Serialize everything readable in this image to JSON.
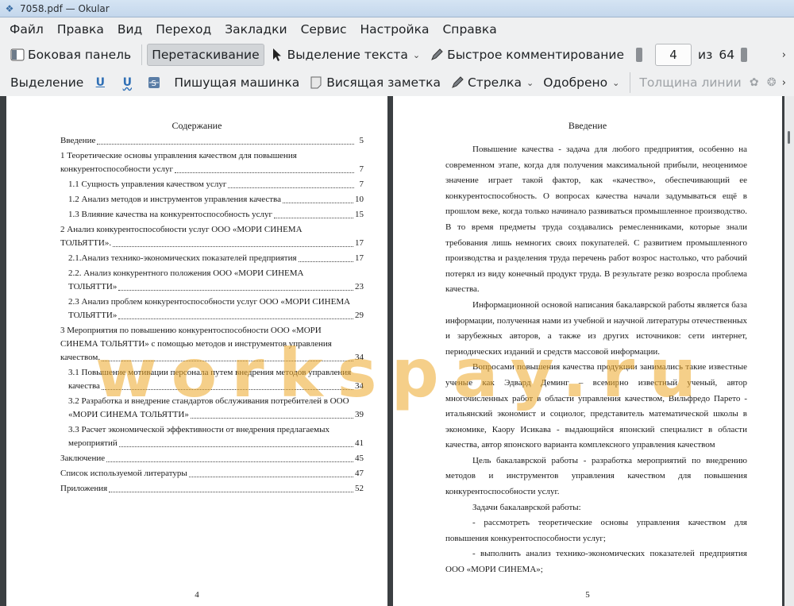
{
  "window": {
    "title": "7058.pdf  — Okular"
  },
  "menu": [
    "Файл",
    "Правка",
    "Вид",
    "Переход",
    "Закладки",
    "Сервис",
    "Настройка",
    "Справка"
  ],
  "toolbar1": {
    "sidebar": "Боковая панель",
    "drag": "Перетаскивание",
    "text_select": "Выделение текста",
    "quick_comment": "Быстрое комментирование",
    "page_current": "4",
    "page_of": "из",
    "page_total": "64"
  },
  "toolbar2": {
    "select": "Выделение",
    "typewriter": "Пишущая машинка",
    "sticky_note": "Висящая заметка",
    "arrow": "Стрелка",
    "approved": "Одобрено",
    "line_width": "Толщина линии"
  },
  "left_page": {
    "title": "Содержание",
    "toc": [
      {
        "lines": [
          "Введение"
        ],
        "page": "5",
        "indent": false
      },
      {
        "lines": [
          "1 Теоретические основы управления качеством для повышения",
          "конкурентоспособности услуг"
        ],
        "page": "7",
        "indent": false
      },
      {
        "lines": [
          "1.1 Сущность управления качеством услуг"
        ],
        "page": "7",
        "indent": true
      },
      {
        "lines": [
          "1.2 Анализ методов и инструментов управления качества"
        ],
        "page": "10",
        "indent": true
      },
      {
        "lines": [
          "1.3 Влияние качества на конкурентоспособность услуг"
        ],
        "page": "15",
        "indent": true
      },
      {
        "lines": [
          "2 Анализ конкурентоспособности услуг ООО «МОРИ СИНЕМА",
          "ТОЛЬЯТТИ»."
        ],
        "page": "17",
        "indent": false
      },
      {
        "lines": [
          "2.1.Анализ технико-экономических показателей предприятия"
        ],
        "page": "17",
        "indent": true
      },
      {
        "lines": [
          "2.2. Анализ конкурентного положения ООО «МОРИ СИНЕМА",
          "ТОЛЬЯТТИ»"
        ],
        "page": "23",
        "indent": true
      },
      {
        "lines": [
          "2.3 Анализ проблем конкурентоспособности услуг ООО «МОРИ СИНЕМА",
          "ТОЛЬЯТТИ»"
        ],
        "page": "29",
        "indent": true
      },
      {
        "lines": [
          "3 Мероприятия по повышению конкурентоспособности ООО «МОРИ",
          "СИНЕМА ТОЛЬЯТТИ» с помощью методов и инструментов управления",
          "качеством."
        ],
        "page": "34",
        "indent": false
      },
      {
        "lines": [
          "3.1 Повышение мотивации персонала путем внедрения методов управления",
          "качества"
        ],
        "page": "34",
        "indent": true
      },
      {
        "lines": [
          "3.2 Разработка и внедрение стандартов обслуживания потребителей в ООО",
          "«МОРИ СИНЕМА ТОЛЬЯТТИ»"
        ],
        "page": "39",
        "indent": true
      },
      {
        "lines": [
          "3.3    Расчет экономической эффективности от внедрения предлагаемых",
          "мероприятий"
        ],
        "page": "41",
        "indent": true
      },
      {
        "lines": [
          "Заключение"
        ],
        "page": "45",
        "indent": false
      },
      {
        "lines": [
          "Список используемой литературы"
        ],
        "page": "47",
        "indent": false
      },
      {
        "lines": [
          "Приложения"
        ],
        "page": "52",
        "indent": false
      }
    ],
    "page_number": "4"
  },
  "right_page": {
    "title": "Введение",
    "paragraphs": [
      "Повышение качества - задача для любого предприятия, особенно на современном этапе, когда для получения максимальной прибыли, неоценимое значение играет такой фактор, как «качество», обеспечивающий ее конкурентоспособность. О вопросах качества начали задумываться ещё в прошлом веке, когда только начинало развиваться промышленное производство. В то время предметы труда создавались ремесленниками, которые знали требования лишь немногих своих покупателей. С развитием промышленного производства и разделения труда перечень работ возрос настолько, что рабочий потерял из виду конечный продукт труда. В результате резко возросла проблема качества.",
      "Информационной основой написания бакалаврской работы является база информации, полученная нами из учебной и научной литературы отечественных и зарубежных авторов, а также из других источников: сети интернет, периодических изданий и средств массовой информации.",
      "Вопросами повышения качества продукции занимались такие известные ученые как Эдвард Деминг – всемирно известный ученый, автор многочисленных работ в области управления качеством, Вильфредо Парето - итальянский экономист и социолог, представитель математической школы в экономике, Каору Исикава - выдающийся японский специалист в области качества, автор японского варианта комплексного управления качеством",
      "Цель бакалаврской работы - разработка мероприятий по внедрению методов и инструментов управления качеством для повышения конкурентоспособности услуг.",
      "Задачи бакалаврской работы:",
      "- рассмотреть теоретические основы управления качеством для повышения конкурентоспособности услуг;",
      "- выполнить анализ технико-экономических показателей предприятия ООО «МОРИ СИНЕМА»;"
    ],
    "page_number": "5"
  },
  "watermark": "workspay.ru"
}
